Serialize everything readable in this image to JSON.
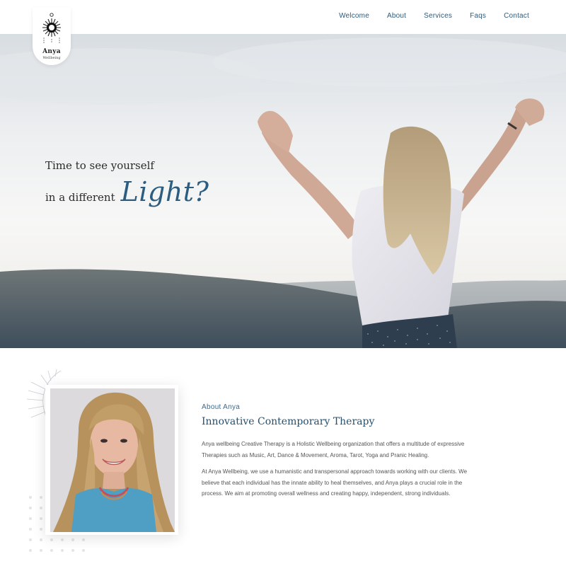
{
  "logo": {
    "name": "Anya",
    "sub": "Wellbeing"
  },
  "nav": {
    "items": [
      "Welcome",
      "About",
      "Services",
      "Faqs",
      "Contact"
    ]
  },
  "hero": {
    "line1": "Time to see yourself",
    "line2": "in a different",
    "highlight": "Light?"
  },
  "about": {
    "kicker": "About Anya",
    "title": "Innovative Contemporary Therapy",
    "paragraph1": "Anya wellbeing Creative Therapy is a Holistic Wellbeing organization that offers a multitude of expressive Therapies such as Music, Art, Dance & Movement, Aroma, Tarot, Yoga and Pranic Healing.",
    "paragraph2": "At Anya Wellbeing, we use a humanistic and transpersonal approach towards working with our clients. We believe that each individual has the innate ability to heal themselves, and Anya plays a crucial role in the process. We aim at promoting overall wellness and creating happy, independent, strong individuals."
  },
  "colors": {
    "accent": "#2c5d80",
    "nav": "#2f5a7a",
    "title": "#24506f"
  }
}
